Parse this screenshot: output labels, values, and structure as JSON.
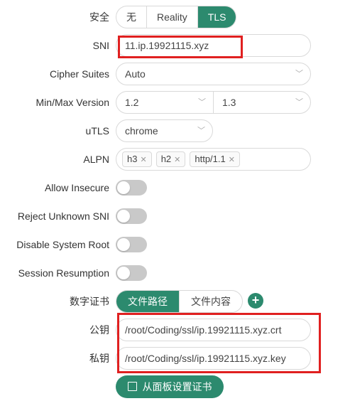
{
  "security": {
    "label": "安全",
    "options": [
      "无",
      "Reality",
      "TLS"
    ],
    "selected": "TLS"
  },
  "sni": {
    "label": "SNI",
    "value": "11.ip.19921115.xyz"
  },
  "cipher_suites": {
    "label": "Cipher Suites",
    "value": "Auto"
  },
  "min_max_version": {
    "label": "Min/Max Version",
    "min": "1.2",
    "max": "1.3"
  },
  "utls": {
    "label": "uTLS",
    "value": "chrome"
  },
  "alpn": {
    "label": "ALPN",
    "tags": [
      "h3",
      "h2",
      "http/1.1"
    ]
  },
  "toggles": [
    {
      "label": "Allow Insecure",
      "on": false
    },
    {
      "label": "Reject Unknown SNI",
      "on": false
    },
    {
      "label": "Disable System Root",
      "on": false
    },
    {
      "label": "Session Resumption",
      "on": false
    }
  ],
  "certificate": {
    "label": "数字证书",
    "options": [
      "文件路径",
      "文件内容"
    ],
    "selected": "文件路径",
    "add_icon": "plus-icon",
    "public_key_label": "公钥",
    "public_key_value": "/root/Coding/ssl/ip.19921115.xyz.crt",
    "private_key_label": "私钥",
    "private_key_value": "/root/Coding/ssl/ip.19921115.xyz.key",
    "panel_button": "从面板设置证书",
    "panel_button_icon": "login-icon"
  },
  "colors": {
    "accent": "#2c8a6e",
    "highlight": "#e02020",
    "toggle_off": "#c9c9c9"
  }
}
